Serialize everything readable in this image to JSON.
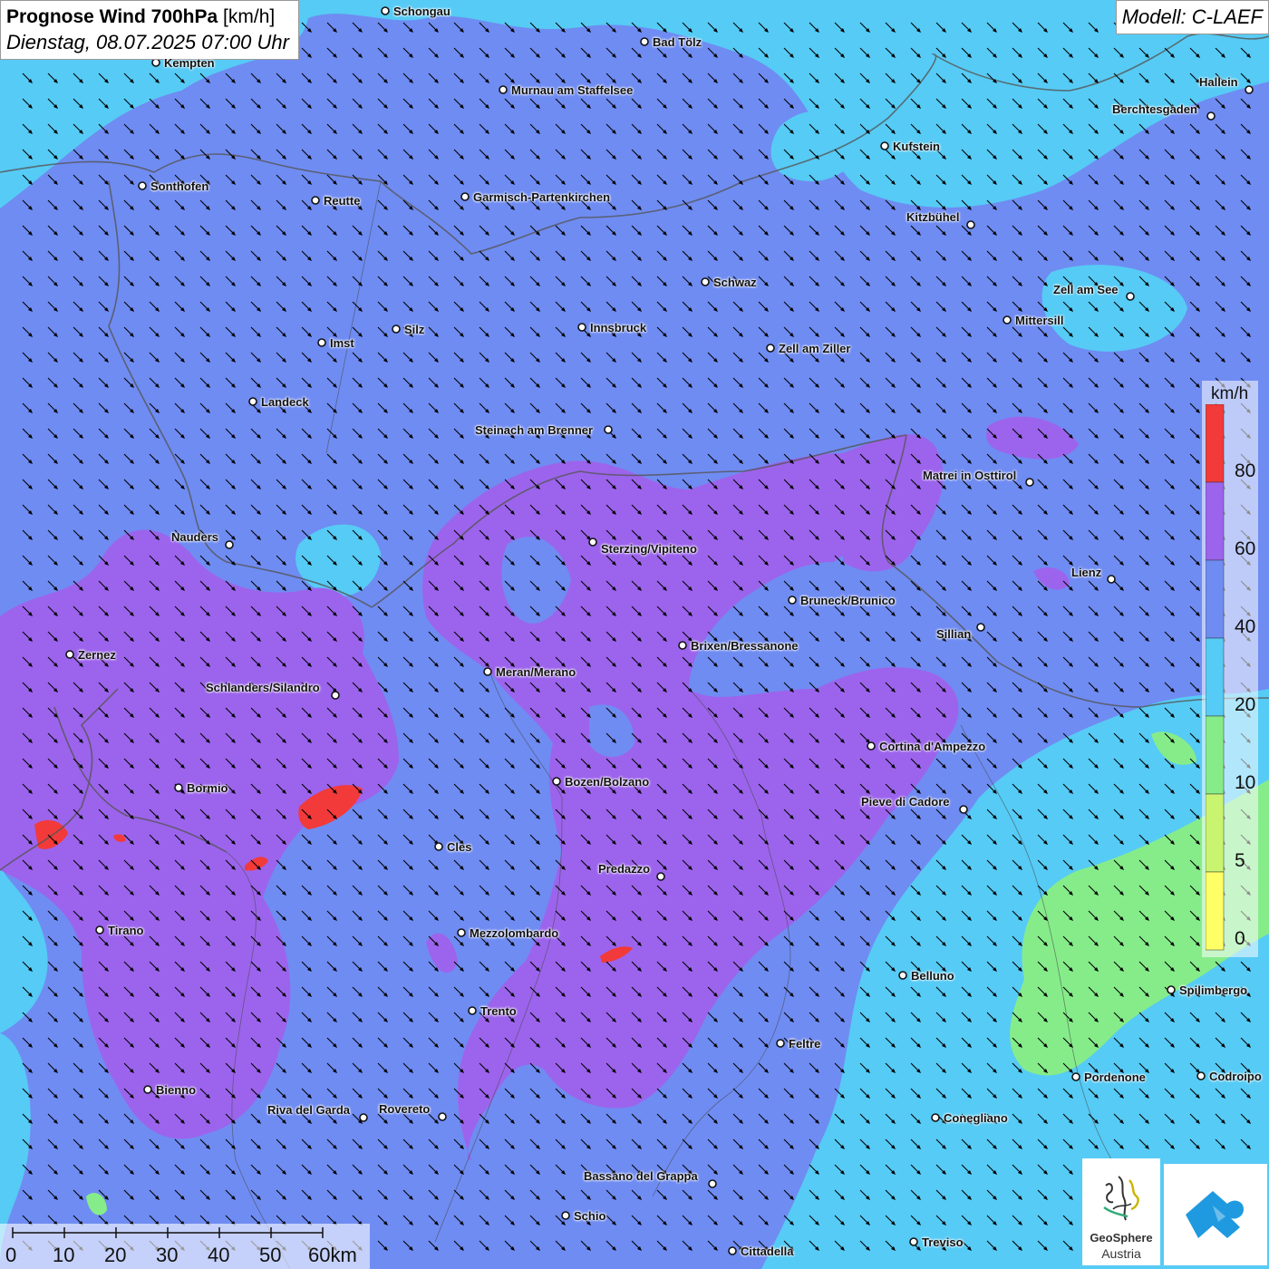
{
  "header": {
    "title_bold": "Prognose Wind 700hPa",
    "title_unit": "[km/h]",
    "datetime": "Dienstag, 08.07.2025 07:00 Uhr",
    "model": "Modell: C-LAEF"
  },
  "colors": {
    "wind_0": "#ffff66",
    "wind_5": "#c9f470",
    "wind_10": "#86ec8a",
    "wind_20": "#56cbf5",
    "wind_40": "#6f8cf2",
    "wind_60": "#9c64ec",
    "wind_80": "#f23a3a",
    "border": "#555555",
    "arrow": "#000000"
  },
  "legend": {
    "unit": "km/h",
    "levels": [
      "80",
      "60",
      "40",
      "20",
      "10",
      "5",
      "0"
    ]
  },
  "scalebar": {
    "labels": [
      "0",
      "10",
      "20",
      "30",
      "40",
      "50",
      "60km"
    ]
  },
  "logos": {
    "geosphere_line1": "GeoSphere",
    "geosphere_line2": "Austria",
    "geosphere_icon": "geosphere-logo-icon",
    "app_icon": "cloud-arrow-logo-icon"
  },
  "wind": {
    "direction": "northwest-to-southeast",
    "arrow_icon": "wind-arrow-icon"
  },
  "cities": [
    "Schongau",
    "Bad Tölz",
    "Kempten",
    "Murnau am Staffelsee",
    "Hallein",
    "Berchtesgaden",
    "Kufstein",
    "Sonthofen",
    "Reutte",
    "Garmisch-Partenkirchen",
    "Kitzbühel",
    "Schwaz",
    "Zell am See",
    "Innsbruck",
    "Silz",
    "Mittersill",
    "Imst",
    "Zell am Ziller",
    "Landeck",
    "Steinach am Brenner",
    "Matrei in Osttirol",
    "Nauders",
    "Sterzing/Vipiteno",
    "Lienz",
    "Bruneck/Brunico",
    "Sillian",
    "Zernez",
    "Brixen/Bressanone",
    "Meran/Merano",
    "Schlanders/Silandro",
    "Cortina d'Ampezzo",
    "Bormio",
    "Bozen/Bolzano",
    "Pieve di Cadore",
    "Cles",
    "Predazzo",
    "Tirano",
    "Mezzolombardo",
    "Belluno",
    "Spilimbergo",
    "Trento",
    "Feltre",
    "Pordenone",
    "Codroipo",
    "Bienno",
    "Riva del Garda",
    "Rovereto",
    "Conegliano",
    "Bassano del Grappa",
    "Schio",
    "Treviso",
    "Cittadella"
  ]
}
